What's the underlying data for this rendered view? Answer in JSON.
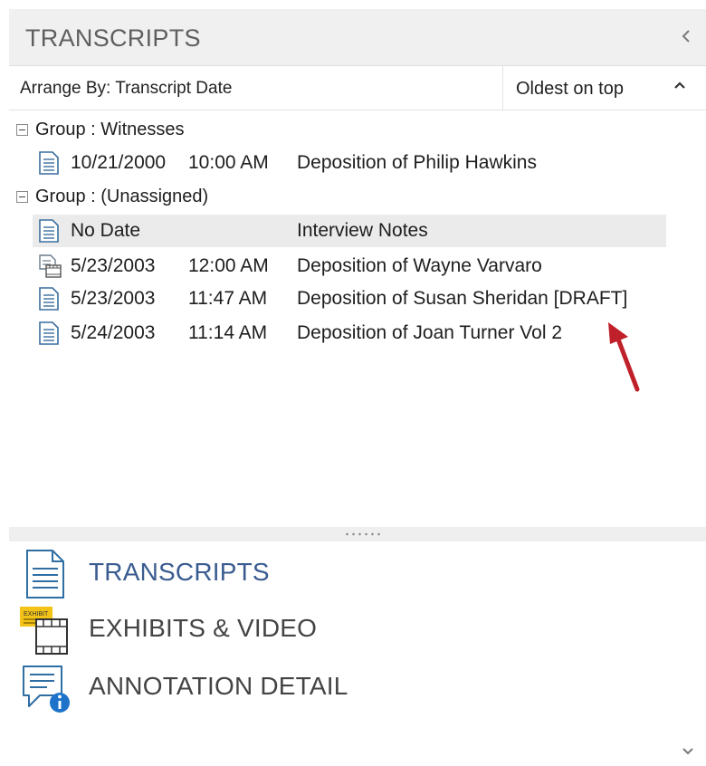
{
  "panel": {
    "title": "TRANSCRIPTS",
    "collapse_icon": "chevron-left-icon"
  },
  "arrange": {
    "label": "Arrange By: Transcript Date",
    "sort_label": "Oldest on top",
    "sort_icon": "caret-up-icon"
  },
  "groups": [
    {
      "label": "Group : Witnesses",
      "items": [
        {
          "date": "10/21/2000",
          "time": "10:00 AM",
          "title": "Deposition of Philip Hawkins",
          "icon": "transcript-icon"
        }
      ]
    },
    {
      "label": "Group : (Unassigned)",
      "items": [
        {
          "date": "No Date",
          "time": "",
          "title": "Interview Notes",
          "icon": "transcript-icon",
          "selected": true
        },
        {
          "date": "5/23/2003",
          "time": "12:00 AM",
          "title": "Deposition of Wayne Varvaro",
          "icon": "video-transcript-icon"
        },
        {
          "date": "5/23/2003",
          "time": "11:47 AM",
          "title": "Deposition of Susan Sheridan [DRAFT]",
          "icon": "transcript-icon"
        },
        {
          "date": "5/24/2003",
          "time": "11:14 AM",
          "title": "Deposition of Joan Turner Vol 2",
          "icon": "transcript-icon"
        }
      ]
    }
  ],
  "nav": [
    {
      "label": "TRANSCRIPTS",
      "icon": "transcripts-icon",
      "active": true
    },
    {
      "label": "EXHIBITS & VIDEO",
      "icon": "exhibits-video-icon",
      "badge": "EXHIBIT"
    },
    {
      "label": "ANNOTATION DETAIL",
      "icon": "annotation-detail-icon"
    }
  ],
  "colors": {
    "accent": "#3a5c90",
    "arrow": "#c0202a",
    "exhibit_badge": "#f3c318",
    "info": "#1d73c9"
  }
}
